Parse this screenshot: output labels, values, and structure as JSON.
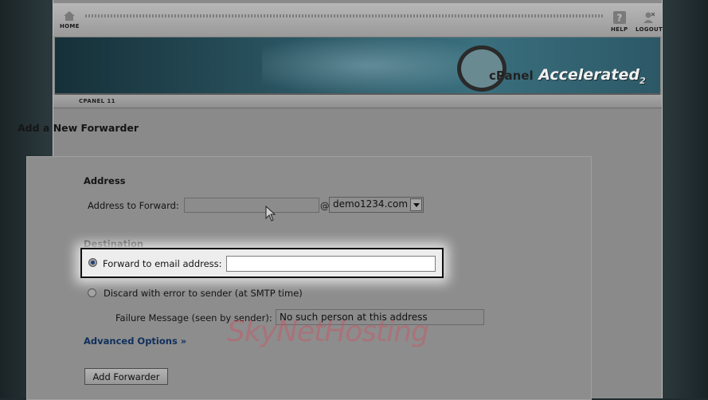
{
  "topbar": {
    "home": "HOME",
    "help": "HELP",
    "logout": "LOGOUT"
  },
  "banner": {
    "brand": "cPanel",
    "product": "Accelerated",
    "version": "2"
  },
  "crumb": "CPANEL 11",
  "page_title": "Add a New Forwarder",
  "address": {
    "heading": "Address",
    "label": "Address to Forward:",
    "value": "",
    "at": "@",
    "domain": "demo1234.com"
  },
  "destination": {
    "heading": "Destination",
    "forward_label": "Forward to email address:",
    "forward_value": "",
    "discard_label": "Discard with error to sender (at SMTP time)",
    "failure_label": "Failure Message (seen by sender):",
    "failure_value": "No such person at this address"
  },
  "advanced": "Advanced Options »",
  "submit": "Add Forwarder",
  "watermark": "SkyNetHosting"
}
